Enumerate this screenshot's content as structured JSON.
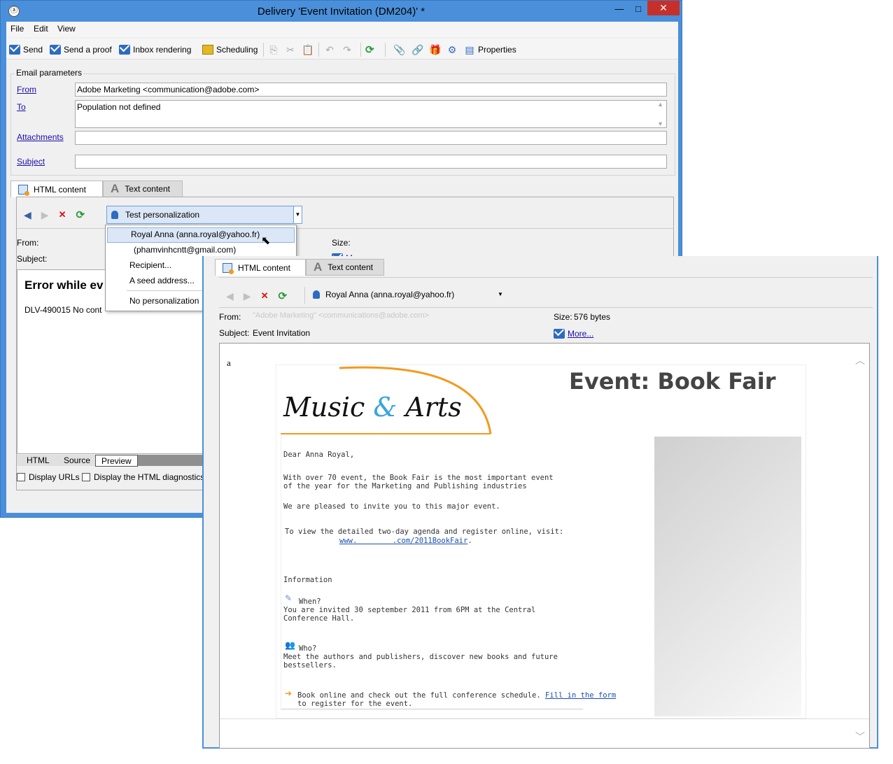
{
  "window": {
    "title": "Delivery 'Event Invitation (DM204)' *",
    "app_icon": "adobe-campaign-icon",
    "controls": {
      "minimize": "—",
      "maximize": "□",
      "close": "✕"
    }
  },
  "menu": [
    "File",
    "Edit",
    "View"
  ],
  "toolbar": {
    "send": "Send",
    "send_proof": "Send a proof",
    "inbox_rendering": "Inbox rendering",
    "scheduling": "Scheduling",
    "properties": "Properties"
  },
  "email_parameters": {
    "title": "Email parameters",
    "from_label": "From",
    "from_value": "Adobe Marketing <communication@adobe.com>",
    "to_label": "To",
    "to_value": "Population not defined",
    "attachments_label": "Attachments",
    "attachments_value": "",
    "subject_label": "Subject",
    "subject_value": ""
  },
  "tabs": {
    "html": "HTML content",
    "text": "Text content"
  },
  "preview_bar": {
    "personalization_value": "Test personalization",
    "from_label": "From:",
    "subject_label": "Subject:",
    "size_label": "Size:",
    "more_link": "More..."
  },
  "dropdown": {
    "items": [
      "Royal Anna (anna.royal@yahoo.fr)",
      "(phamvinhcntt@gmail.com)",
      "Recipient...",
      "A seed address...",
      "No personalization"
    ]
  },
  "error": {
    "title": "Error while ev",
    "message": "DLV-490015 No cont"
  },
  "bottom_tabs": [
    "HTML",
    "Source",
    "Preview"
  ],
  "options": {
    "display_urls": "Display URLs",
    "display_html_diag": "Display the HTML diagnostics"
  },
  "second": {
    "tabs": {
      "html": "HTML content",
      "text": "Text content"
    },
    "personalization_value": "Royal Anna (anna.royal@yahoo.fr)",
    "from_label": "From:",
    "from_value": "\"Adobe Marketing\" <communications@adobe.com>",
    "size_label": "Size:",
    "size_value": "576 bytes",
    "subject_label": "Subject:",
    "subject_value": "Event Invitation",
    "more_link": "More...",
    "email": {
      "letter": "a",
      "logo_music": "Music",
      "logo_amp": "&",
      "logo_arts": "Arts",
      "heading": "Event: Book Fair",
      "greeting": "Dear Anna Royal,",
      "p1": "With over 70 event, the Book Fair is the most important event\nof the year for the Marketing and Publishing industries",
      "p2": "We are pleased to invite you to this major event.",
      "p3": "To view the detailed two-day agenda and register online, visit:",
      "url": "www.        .com/2011BookFair",
      "url_end": ".",
      "info_title": "Information",
      "when_label": "When?",
      "when_text": "You are invited 30 september 2011 from 6PM at the Central\nConference Hall.",
      "who_label": "Who?",
      "who_text": "Meet the authors and publishers, discover new books and future\nbestsellers.",
      "book_text": "Book online and check out the full conference schedule.",
      "fill_link": "Fill in the form",
      "book_text2": "to register for the event."
    }
  },
  "colors": {
    "titlebar": "#4a8fd9",
    "close": "#c7302a",
    "accent": "#2d6cc0",
    "logo_arc": "#f39a1e"
  }
}
